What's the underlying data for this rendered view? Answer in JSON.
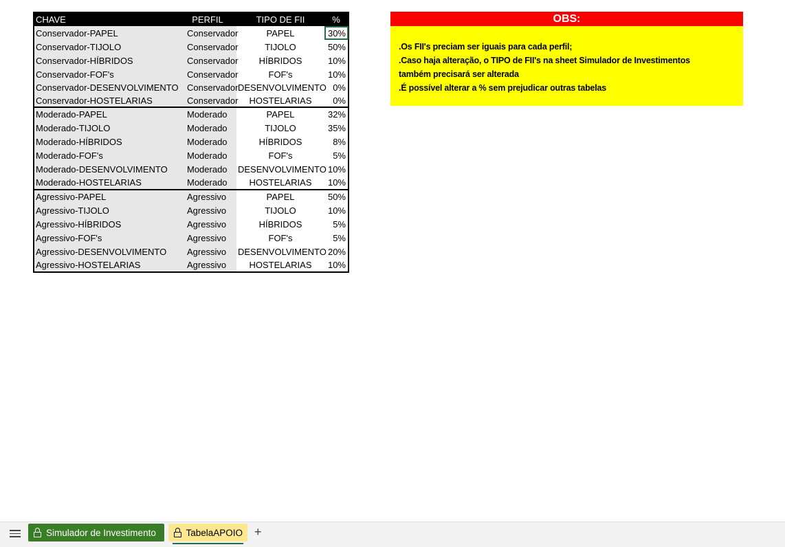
{
  "table": {
    "headers": {
      "chave": "CHAVE",
      "perfil": "PERFIL",
      "tipo": "TIPO DE FII",
      "pct": "%"
    },
    "rows": [
      {
        "chave": "Conservador-PAPEL",
        "perfil": "Conservador",
        "tipo": "PAPEL",
        "pct": "30%"
      },
      {
        "chave": "Conservador-TIJOLO",
        "perfil": "Conservador",
        "tipo": "TIJOLO",
        "pct": "50%"
      },
      {
        "chave": "Conservador-HÍBRIDOS",
        "perfil": "Conservador",
        "tipo": "HÍBRIDOS",
        "pct": "10%"
      },
      {
        "chave": "Conservador-FOF's",
        "perfil": "Conservador",
        "tipo": "FOF's",
        "pct": "10%"
      },
      {
        "chave": "Conservador-DESENVOLVIMENTO",
        "perfil": "Conservador",
        "tipo": "DESENVOLVIMENTO",
        "pct": "0%"
      },
      {
        "chave": "Conservador-HOSTELARIAS",
        "perfil": "Conservador",
        "tipo": "HOSTELARIAS",
        "pct": "0%"
      },
      {
        "chave": "Moderado-PAPEL",
        "perfil": "Moderado",
        "tipo": "PAPEL",
        "pct": "32%"
      },
      {
        "chave": "Moderado-TIJOLO",
        "perfil": "Moderado",
        "tipo": "TIJOLO",
        "pct": "35%"
      },
      {
        "chave": "Moderado-HÍBRIDOS",
        "perfil": "Moderado",
        "tipo": "HÍBRIDOS",
        "pct": "8%"
      },
      {
        "chave": "Moderado-FOF's",
        "perfil": "Moderado",
        "tipo": "FOF's",
        "pct": "5%"
      },
      {
        "chave": "Moderado-DESENVOLVIMENTO",
        "perfil": "Moderado",
        "tipo": "DESENVOLVIMENTO",
        "pct": "10%"
      },
      {
        "chave": "Moderado-HOSTELARIAS",
        "perfil": "Moderado",
        "tipo": "HOSTELARIAS",
        "pct": "10%"
      },
      {
        "chave": "Agressivo-PAPEL",
        "perfil": "Agressivo",
        "tipo": "PAPEL",
        "pct": "50%"
      },
      {
        "chave": "Agressivo-TIJOLO",
        "perfil": "Agressivo",
        "tipo": "TIJOLO",
        "pct": "10%"
      },
      {
        "chave": "Agressivo-HÍBRIDOS",
        "perfil": "Agressivo",
        "tipo": "HÍBRIDOS",
        "pct": "5%"
      },
      {
        "chave": "Agressivo-FOF's",
        "perfil": "Agressivo",
        "tipo": "FOF's",
        "pct": "5%"
      },
      {
        "chave": "Agressivo-DESENVOLVIMENTO",
        "perfil": "Agressivo",
        "tipo": "DESENVOLVIMENTO",
        "pct": "20%"
      },
      {
        "chave": "Agressivo-HOSTELARIAS",
        "perfil": "Agressivo",
        "tipo": "HOSTELARIAS",
        "pct": "10%"
      }
    ]
  },
  "obs": {
    "title": "OBS:",
    "lines": [
      ".Os FII's preciam ser iguais para cada perfil;",
      ".Caso haja alteração, o TIPO de FII's na sheet Simulador de Investimentos",
      "também precisará ser alterada",
      ".É possível alterar a % sem prejudicar outras tabelas"
    ]
  },
  "tabs": {
    "menu_icon": "hamburger-menu-icon",
    "items": [
      {
        "label": "Simulador de Investimento",
        "icon": "lock-icon",
        "color": "#3a7d27"
      },
      {
        "label": "TabelaAPOIO",
        "icon": "lock-icon",
        "color": "#fde88f"
      }
    ],
    "add_label": "+"
  },
  "colors": {
    "obs_header": "#ff0000",
    "obs_body": "#ffff00",
    "key_cols": "#e7e7e7",
    "selection": "#1e7145"
  }
}
